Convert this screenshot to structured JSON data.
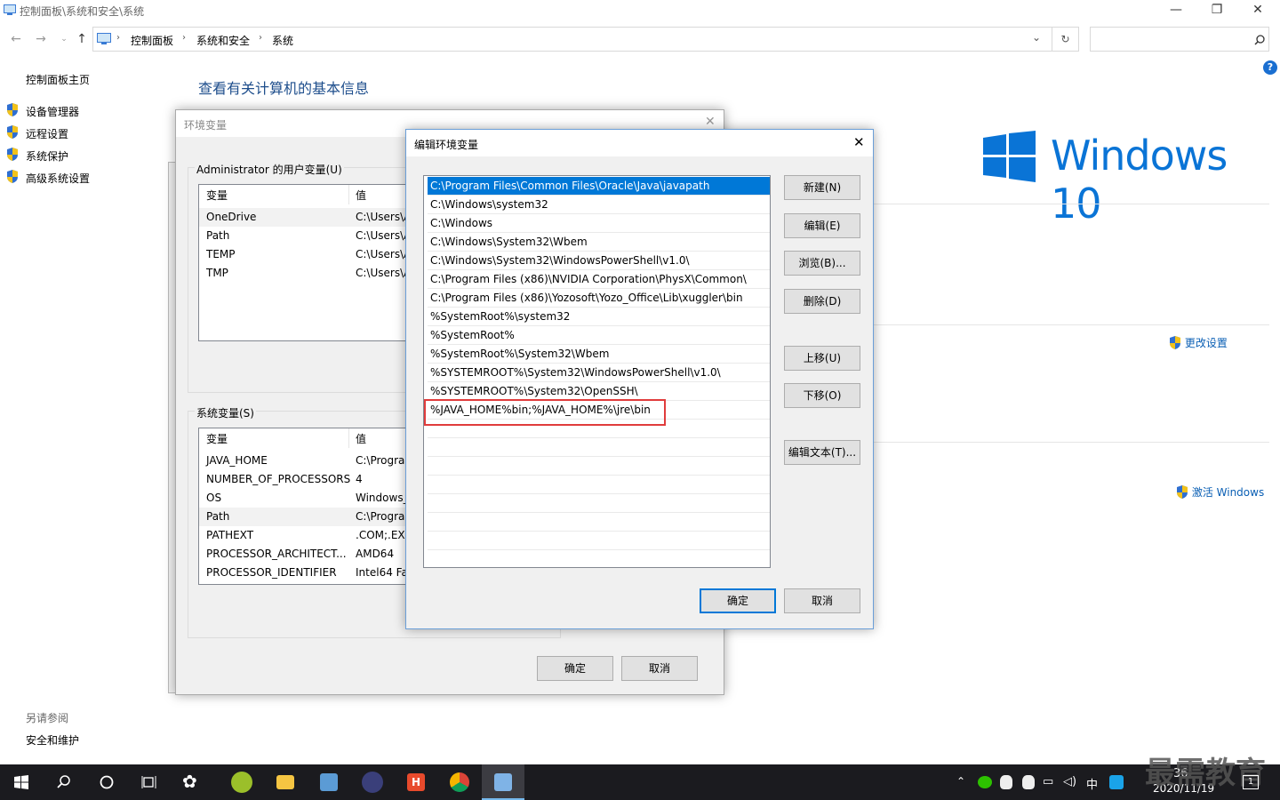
{
  "window": {
    "title": "控制面板\\系统和安全\\系统",
    "minimize": "—",
    "maximize": "❐",
    "close": "✕"
  },
  "breadcrumb": [
    "控制面板",
    "系统和安全",
    "系统"
  ],
  "search": {
    "placeholder": ""
  },
  "left_panel": {
    "home": "控制面板主页",
    "items": [
      "设备管理器",
      "远程设置",
      "系统保护",
      "高级系统设置"
    ],
    "see_also_title": "另请参阅",
    "see_also": "安全和维护"
  },
  "main": {
    "title": "查看有关计算机的基本信息",
    "windows_brand": "Windows 10",
    "change_settings": "更改设置",
    "activate": "激活 Windows"
  },
  "env_dialog": {
    "title": "环境变量",
    "user_group": "Administrator 的用户变量(U)",
    "columns": [
      "变量",
      "值"
    ],
    "user_vars": [
      {
        "name": "OneDrive",
        "value": "C:\\Users\\A"
      },
      {
        "name": "Path",
        "value": "C:\\Users\\A"
      },
      {
        "name": "TEMP",
        "value": "C:\\Users\\A"
      },
      {
        "name": "TMP",
        "value": "C:\\Users\\A"
      }
    ],
    "system_group": "系统变量(S)",
    "system_vars": [
      {
        "name": "JAVA_HOME",
        "value": "C:\\Progra"
      },
      {
        "name": "NUMBER_OF_PROCESSORS",
        "value": "4"
      },
      {
        "name": "OS",
        "value": "Windows_"
      },
      {
        "name": "Path",
        "value": "C:\\Progra"
      },
      {
        "name": "PATHEXT",
        "value": ".COM;.EXE"
      },
      {
        "name": "PROCESSOR_ARCHITECT...",
        "value": "AMD64"
      },
      {
        "name": "PROCESSOR_IDENTIFIER",
        "value": "Intel64 Fa"
      }
    ],
    "ok": "确定",
    "cancel": "取消"
  },
  "edit_dialog": {
    "title": "编辑环境变量",
    "paths": [
      "C:\\Program Files\\Common Files\\Oracle\\Java\\javapath",
      "C:\\Windows\\system32",
      "C:\\Windows",
      "C:\\Windows\\System32\\Wbem",
      "C:\\Windows\\System32\\WindowsPowerShell\\v1.0\\",
      "C:\\Program Files (x86)\\NVIDIA Corporation\\PhysX\\Common\\",
      "C:\\Program Files (x86)\\Yozosoft\\Yozo_Office\\Lib\\xuggler\\bin",
      "%SystemRoot%\\system32",
      "%SystemRoot%",
      "%SystemRoot%\\System32\\Wbem",
      "%SYSTEMROOT%\\System32\\WindowsPowerShell\\v1.0\\",
      "%SYSTEMROOT%\\System32\\OpenSSH\\",
      "%JAVA_HOME%bin;%JAVA_HOME%\\jre\\bin"
    ],
    "buttons": {
      "new": "新建(N)",
      "edit": "编辑(E)",
      "browse": "浏览(B)...",
      "delete": "删除(D)",
      "up": "上移(U)",
      "down": "下移(O)",
      "edit_text": "编辑文本(T)..."
    },
    "ok": "确定",
    "cancel": "取消"
  },
  "taskbar": {
    "ime": "中",
    "date": "2020/11/19",
    "time": "36",
    "watermark": "最需教育",
    "notification_count": "1"
  },
  "colors": {
    "accent": "#0078d7",
    "highlight_box": "#e03c3c",
    "link": "#0a5fb4"
  }
}
